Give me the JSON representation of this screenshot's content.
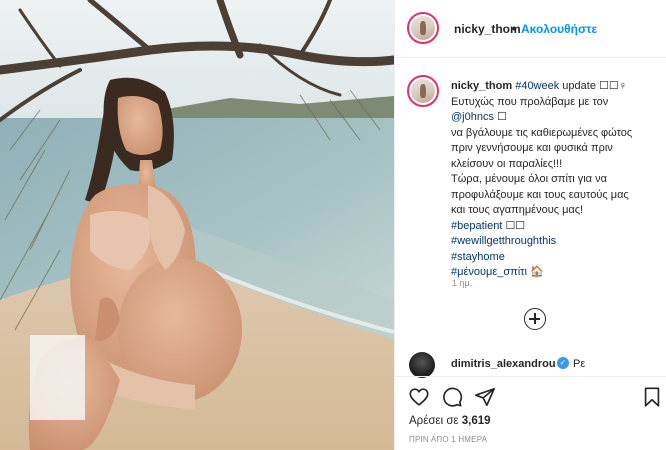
{
  "post": {
    "username": "nicky_thom",
    "follow_separator": "•",
    "follow_label": "Ακολουθήστε",
    "caption": {
      "username": "nicky_thom",
      "hashtag_week": "#40week",
      "line1_rest": " update ☐☐♀",
      "line2_prefix": "Ευτυχώς που προλάβαμε με τον",
      "mention": "@j0hncs",
      "mention_suffix": " ☐",
      "line4": "να βγάλουμε τις καθιερωμένες φώτος",
      "line5": "πριν γεννήσουμε και φυσικά πριν",
      "line6": "κλείσουν οι παραλίες!!!",
      "line7": "Τώρα, μένουμε όλοι σπίτι για να",
      "line8": "προφυλάξουμε και τους εαυτούς μας",
      "line9": "και τους αγαπημένους μας!",
      "tag1": "#bepatient",
      "tag1_suffix": " ☐☐",
      "tag2": "#wewillgetthroughthis",
      "tag3": "#stayhome",
      "tag4": "#μένουμε_σπίτι",
      "tag4_suffix": " 🏠"
    },
    "time_ago": "1 ημ.",
    "comment": {
      "username": "dimitris_alexandrou",
      "verified_glyph": "✓",
      "text": "Ρε"
    },
    "likes_prefix": "Αρέσει σε ",
    "likes_count": "3,619",
    "posted_label": "ΠΡΙΝ ΑΠΟ 1 ΗΜΕΡΑ",
    "colors": {
      "accent_blue": "#0095f6",
      "link": "#00376b",
      "text": "#262626",
      "muted": "#8e8e8e",
      "story_ring": "#e1306c"
    }
  }
}
